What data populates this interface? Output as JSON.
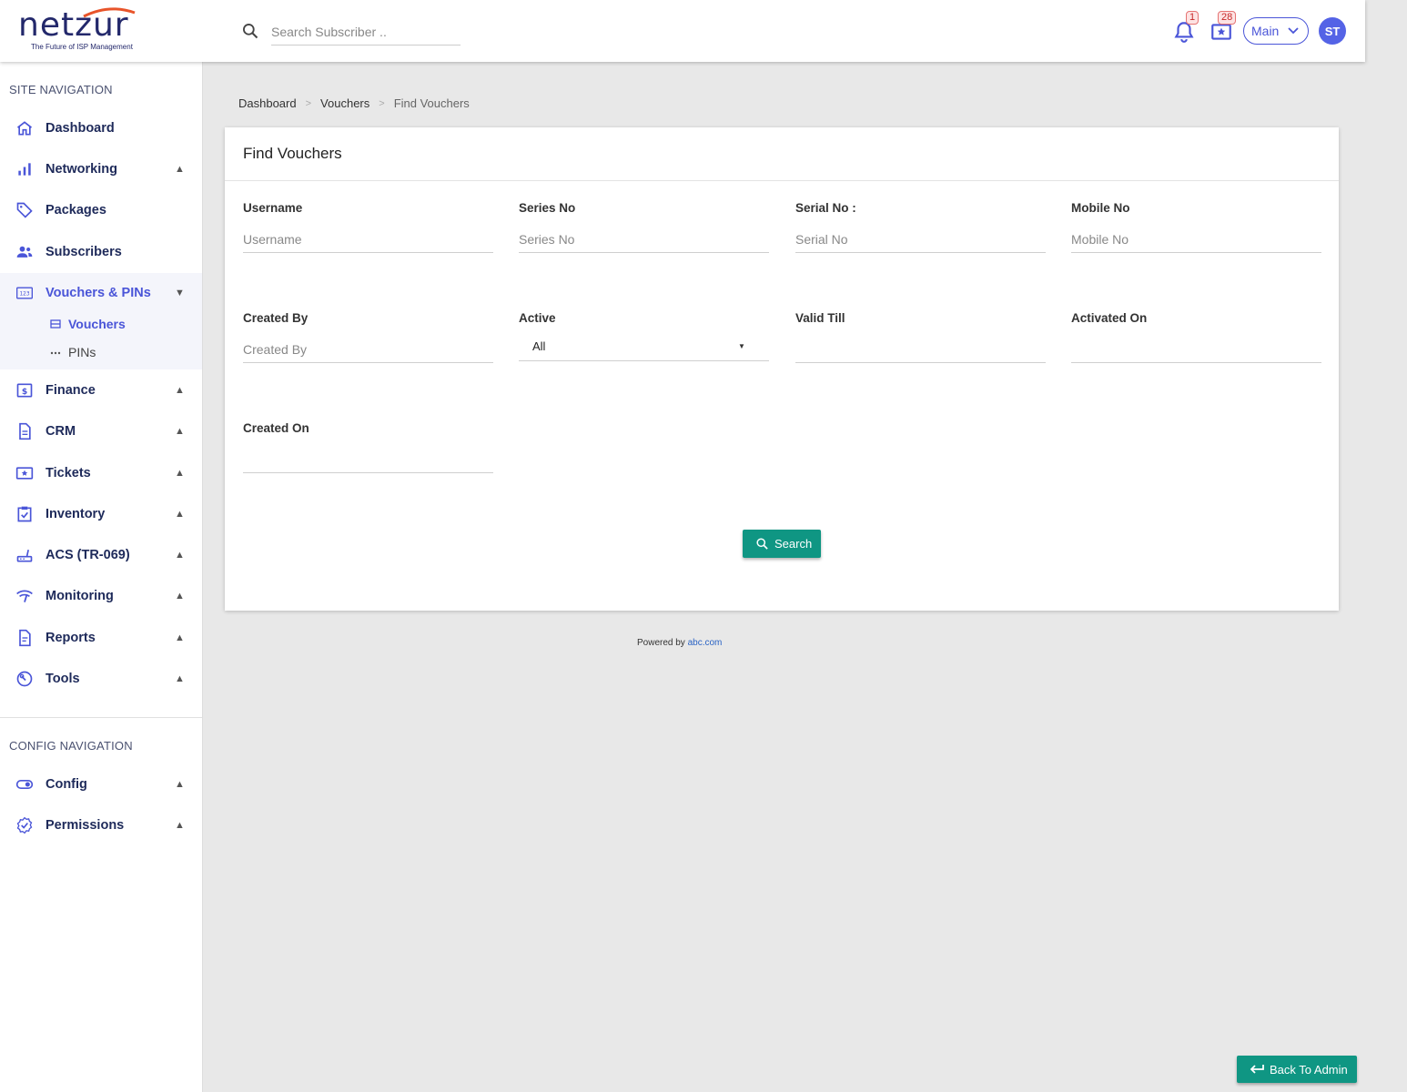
{
  "header": {
    "logo_text": "netzur",
    "logo_tagline": "The Future of ISP Management",
    "search_placeholder": "Search Subscriber ..",
    "notifications_count": "1",
    "tickets_count": "28",
    "main_select": "Main",
    "avatar_initials": "ST"
  },
  "sidebar": {
    "site_nav_title": "SITE NAVIGATION",
    "items": [
      {
        "label": "Dashboard",
        "icon": "home-icon"
      },
      {
        "label": "Networking",
        "icon": "bar-chart-icon"
      },
      {
        "label": "Packages",
        "icon": "tag-icon"
      },
      {
        "label": "Subscribers",
        "icon": "users-icon"
      },
      {
        "label": "Vouchers & PINs",
        "icon": "numbers-icon"
      },
      {
        "label": "Finance",
        "icon": "dollar-icon"
      },
      {
        "label": "CRM",
        "icon": "document-icon"
      },
      {
        "label": "Tickets",
        "icon": "ticket-icon"
      },
      {
        "label": "Inventory",
        "icon": "clipboard-check-icon"
      },
      {
        "label": "ACS (TR-069)",
        "icon": "router-icon"
      },
      {
        "label": "Monitoring",
        "icon": "wifi-monitor-icon"
      },
      {
        "label": "Reports",
        "icon": "report-icon"
      },
      {
        "label": "Tools",
        "icon": "wrench-icon"
      }
    ],
    "sub_items": [
      {
        "label": "Vouchers",
        "icon": "card-icon"
      },
      {
        "label": "PINs",
        "icon": "dots-icon"
      }
    ],
    "config_nav_title": "CONFIG NAVIGATION",
    "config_items": [
      {
        "label": "Config",
        "icon": "toggle-icon"
      },
      {
        "label": "Permissions",
        "icon": "badge-check-icon"
      }
    ]
  },
  "breadcrumb": {
    "items": [
      "Dashboard",
      "Vouchers",
      "Find Vouchers"
    ]
  },
  "form": {
    "title": "Find Vouchers",
    "username_label": "Username",
    "username_placeholder": "Username",
    "series_label": "Series No",
    "series_placeholder": "Series No",
    "serial_label": "Serial No :",
    "serial_placeholder": "Serial No",
    "mobile_label": "Mobile No",
    "mobile_placeholder": "Mobile No",
    "created_by_label": "Created By",
    "created_by_placeholder": "Created By",
    "active_label": "Active",
    "active_value": "All",
    "valid_till_label": "Valid Till",
    "activated_on_label": "Activated On",
    "created_on_label": "Created On",
    "search_button": "Search"
  },
  "footer": {
    "powered_text": "Powered by",
    "powered_link": "abc.com"
  },
  "back_button": "Back To Admin",
  "colors": {
    "accent": "#4a55d8",
    "primary_button": "#0f9683",
    "nav_text": "#1e2a5a"
  }
}
